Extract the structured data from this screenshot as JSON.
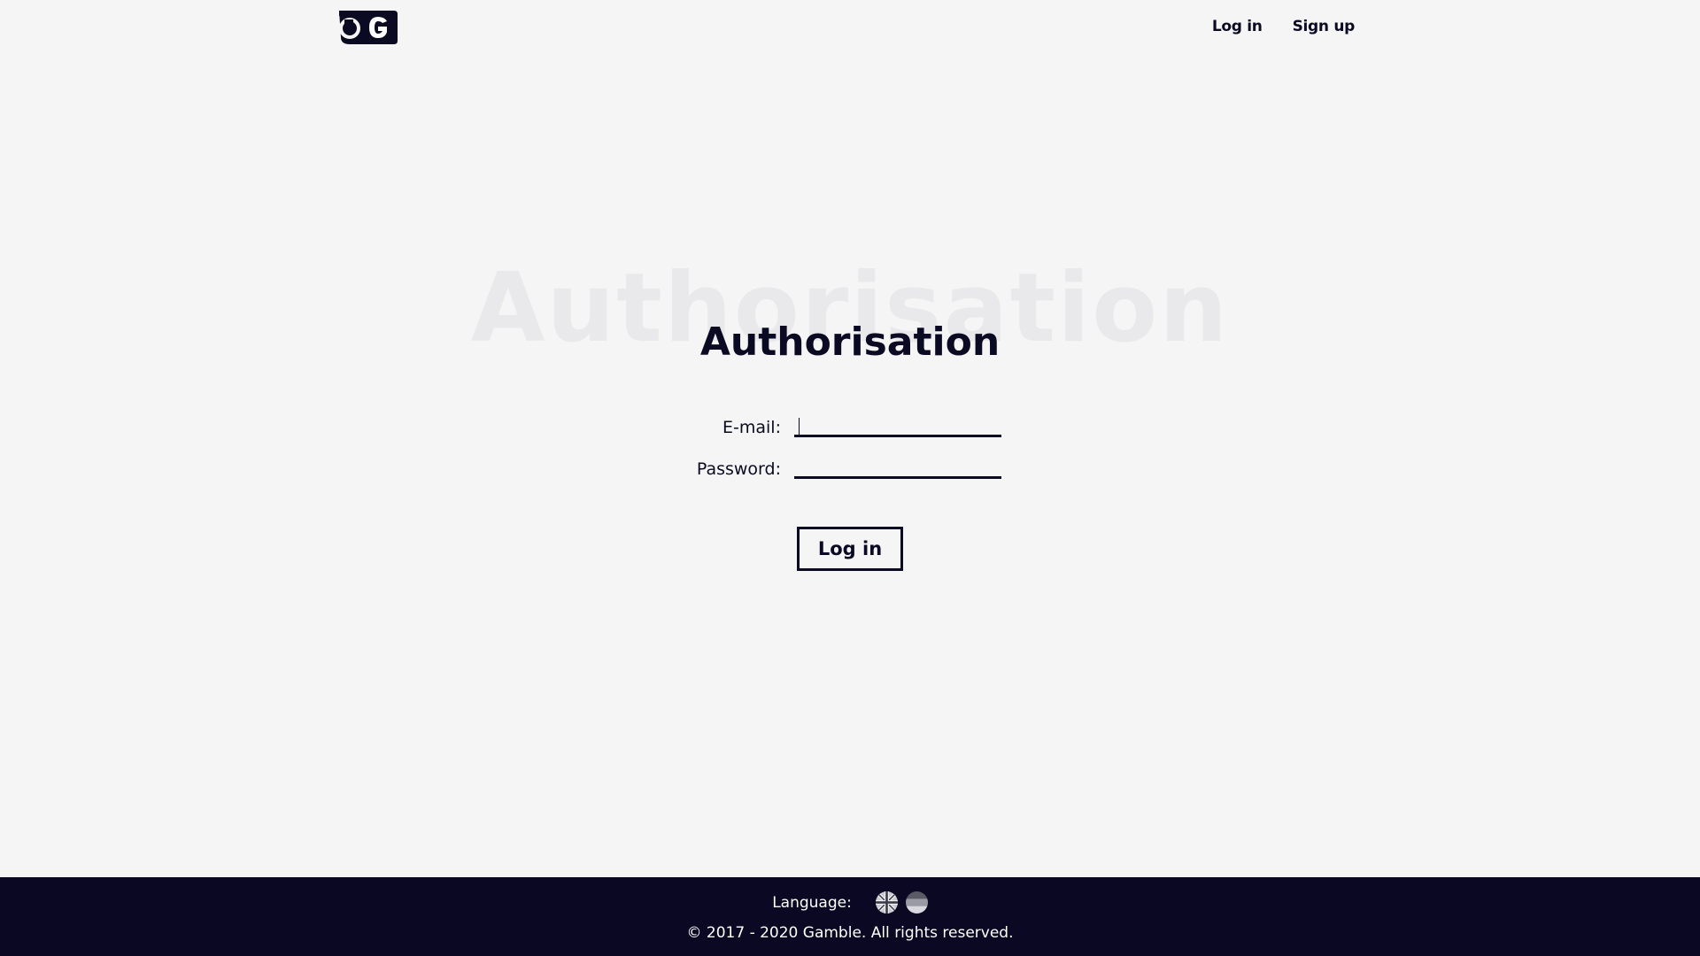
{
  "header": {
    "logo_icon": "gamble-logo-icon",
    "nav": {
      "login_label": "Log in",
      "signup_label": "Sign up"
    }
  },
  "main": {
    "title_ghost": "Authorisation",
    "title": "Authorisation",
    "form": {
      "email_label": "E-mail:",
      "email_value": "",
      "password_label": "Password:",
      "password_value": "",
      "submit_label": "Log in"
    }
  },
  "footer": {
    "language_label": "Language:",
    "flags": [
      "uk-flag-icon",
      "de-flag-icon"
    ],
    "copyright": "© 2017 - 2020 Gamble. All rights reserved."
  },
  "colors": {
    "background": "#f5f5f6",
    "text": "#0a0a23",
    "ghost_title": "#e9e9ec",
    "footer_background": "#0a0822"
  }
}
